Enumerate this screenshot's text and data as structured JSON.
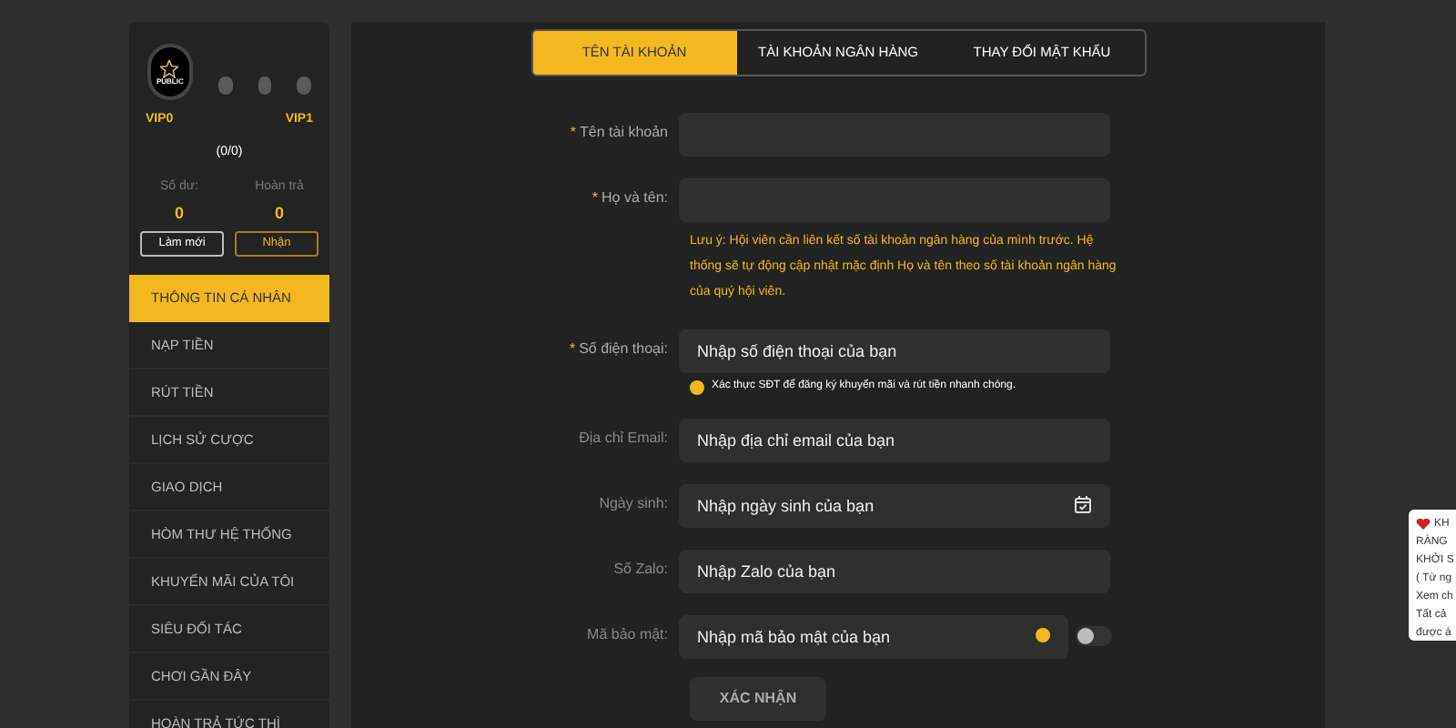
{
  "sidebar": {
    "avatar_label": "PUBLIC",
    "vip_from": "VIP0",
    "vip_to": "VIP1",
    "vip_count": "(0/0)",
    "balance": {
      "label": "Số dư:",
      "value": "0"
    },
    "rebate": {
      "label": "Hoàn trả",
      "value": "0"
    },
    "buttons": [
      {
        "label": "Làm mới",
        "kind": "refresh"
      },
      {
        "label": "Nhận",
        "kind": "claim"
      }
    ],
    "items": [
      {
        "label": "THÔNG TIN CÁ NHÂN",
        "selected": true
      },
      {
        "label": "NẠP TIỀN",
        "selected": false
      },
      {
        "label": "RÚT TIỀN",
        "selected": false
      },
      {
        "label": "LỊCH SỬ CƯỢC",
        "selected": false
      },
      {
        "label": "GIAO DỊCH",
        "selected": false
      },
      {
        "label": "HÒM THƯ HỆ THỐNG",
        "selected": false
      },
      {
        "label": "KHUYẾN MÃI CỦA TÔI",
        "selected": false
      },
      {
        "label": "SIÊU ĐỐI TÁC",
        "selected": false
      },
      {
        "label": "CHƠI GẦN ĐÂY",
        "selected": false
      },
      {
        "label": "HOÀN TRẢ TỨC THÌ",
        "selected": false
      }
    ]
  },
  "tabs": [
    {
      "label": "TÊN TÀI KHOẢN",
      "selected": true
    },
    {
      "label": "TÀI KHOẢN NGÂN HÀNG",
      "selected": false
    },
    {
      "label": "THAY ĐỔI MẬT KHẨU",
      "selected": false
    }
  ],
  "form": [
    {
      "label": "Tên tài khoản",
      "required_mark": "*",
      "kind": "text"
    },
    {
      "label": "Họ và tên:",
      "required_mark": "*",
      "kind": "text",
      "note": "Lưu ý: Hội viên cần liên kết số tài khoản ngân hàng của mình trước. Hệ thống sẽ tự động cập nhật mặc định Họ và tên theo số tài khoản ngân hàng của quý hội viên."
    },
    {
      "label": "Số điện thoại:",
      "required_mark": "*",
      "kind": "text",
      "placeholder": "Nhập số điện thoại của bạn",
      "hint": "Xác thực SĐT để đăng ký khuyến mãi và rút tiền nhanh chóng."
    },
    {
      "label": "Địa chỉ Email:",
      "kind": "text",
      "placeholder": "Nhập địa chỉ email của bạn"
    },
    {
      "label": "Ngày sinh:",
      "kind": "date",
      "placeholder": "Nhập ngày sinh của bạn"
    },
    {
      "label": "Số Zalo:",
      "kind": "text",
      "placeholder": "Nhập Zalo của bạn"
    },
    {
      "label": "Mã bảo mật:",
      "kind": "secure",
      "placeholder": "Nhập mã bảo mật của bạn",
      "on": false
    }
  ],
  "submit": "XÁC NHẬN",
  "popup": {
    "lines": [
      "KH",
      "RÀNG",
      "KHỞI S",
      "( Từ ng",
      "Xem ch",
      "Tất cả",
      "được á"
    ]
  }
}
